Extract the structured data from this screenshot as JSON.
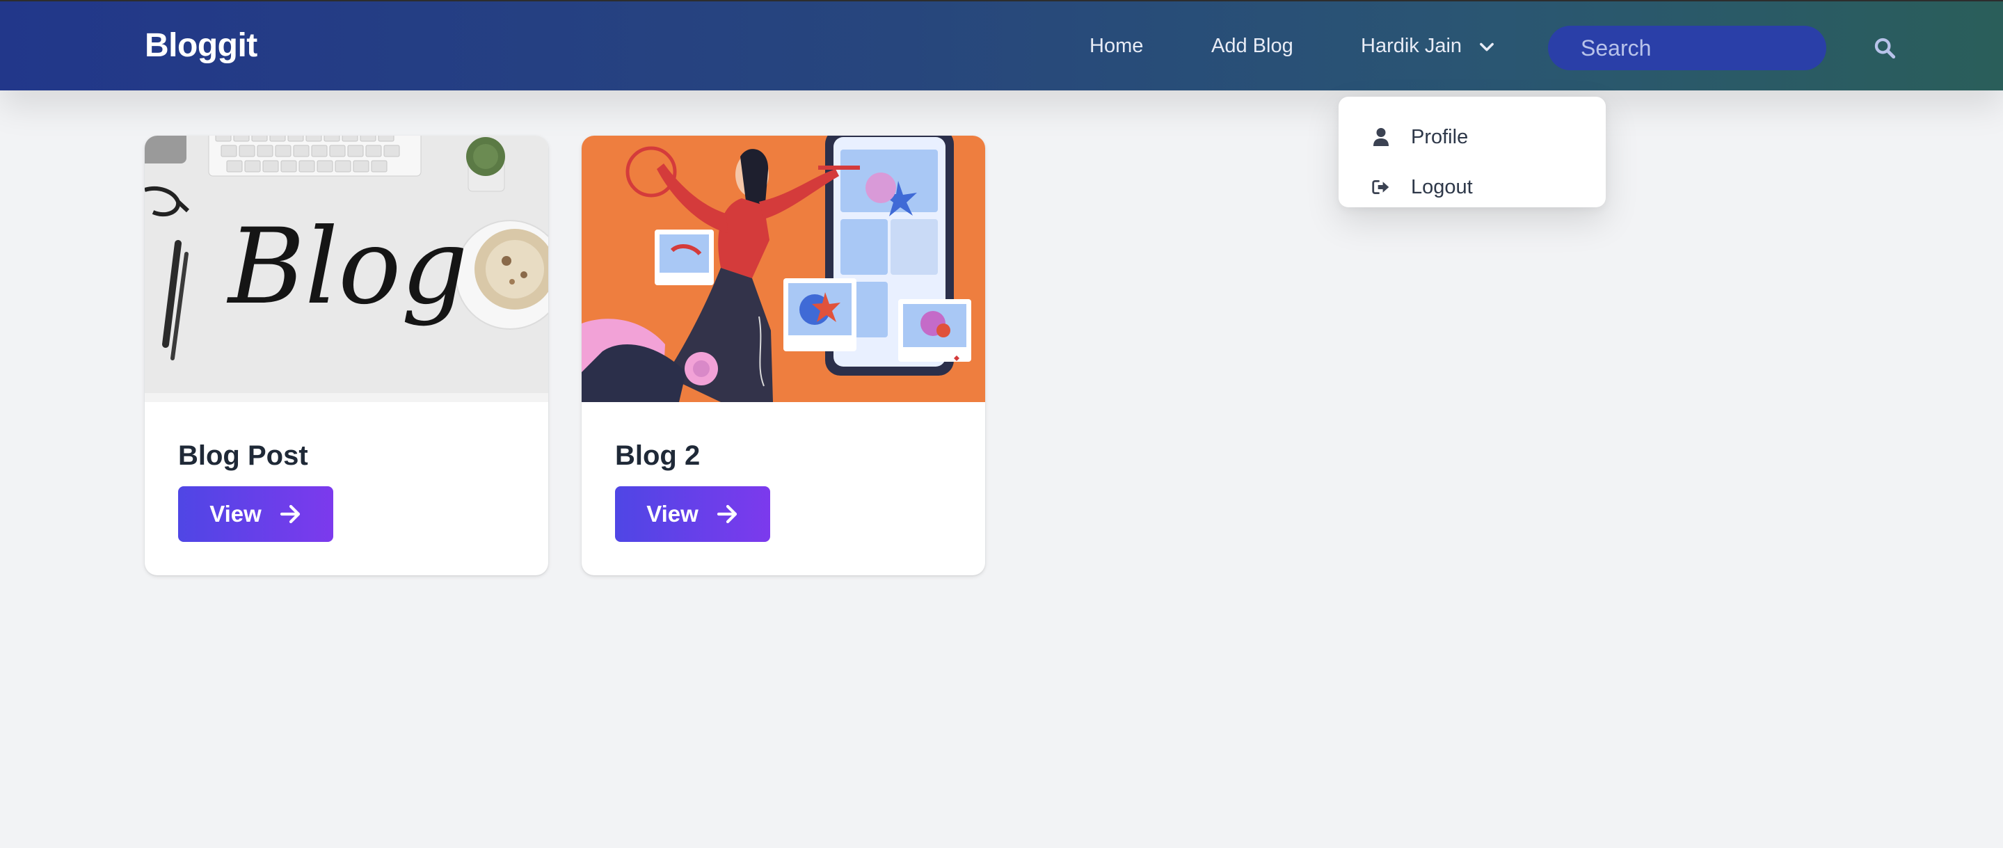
{
  "navbar": {
    "brand": "Bloggit",
    "links": {
      "home": "Home",
      "add_blog": "Add Blog",
      "user": "Hardik Jain"
    },
    "search": {
      "placeholder": "Search"
    }
  },
  "dropdown": {
    "items": [
      {
        "label": "Profile",
        "icon": "user-icon"
      },
      {
        "label": "Logout",
        "icon": "logout-icon"
      }
    ]
  },
  "cards": [
    {
      "title": "Blog Post",
      "button_label": "View",
      "image": "blog-lettering-desk-photo"
    },
    {
      "title": "Blog 2",
      "button_label": "View",
      "image": "woman-social-media-illustration"
    }
  ],
  "colors": {
    "nav_gradient_start": "#22378a",
    "nav_gradient_end": "#2a5e5a",
    "search_bg": "#2a3fa8",
    "button_start": "#4f46e5",
    "button_end": "#7c3aed",
    "page_bg": "#f2f3f5"
  }
}
